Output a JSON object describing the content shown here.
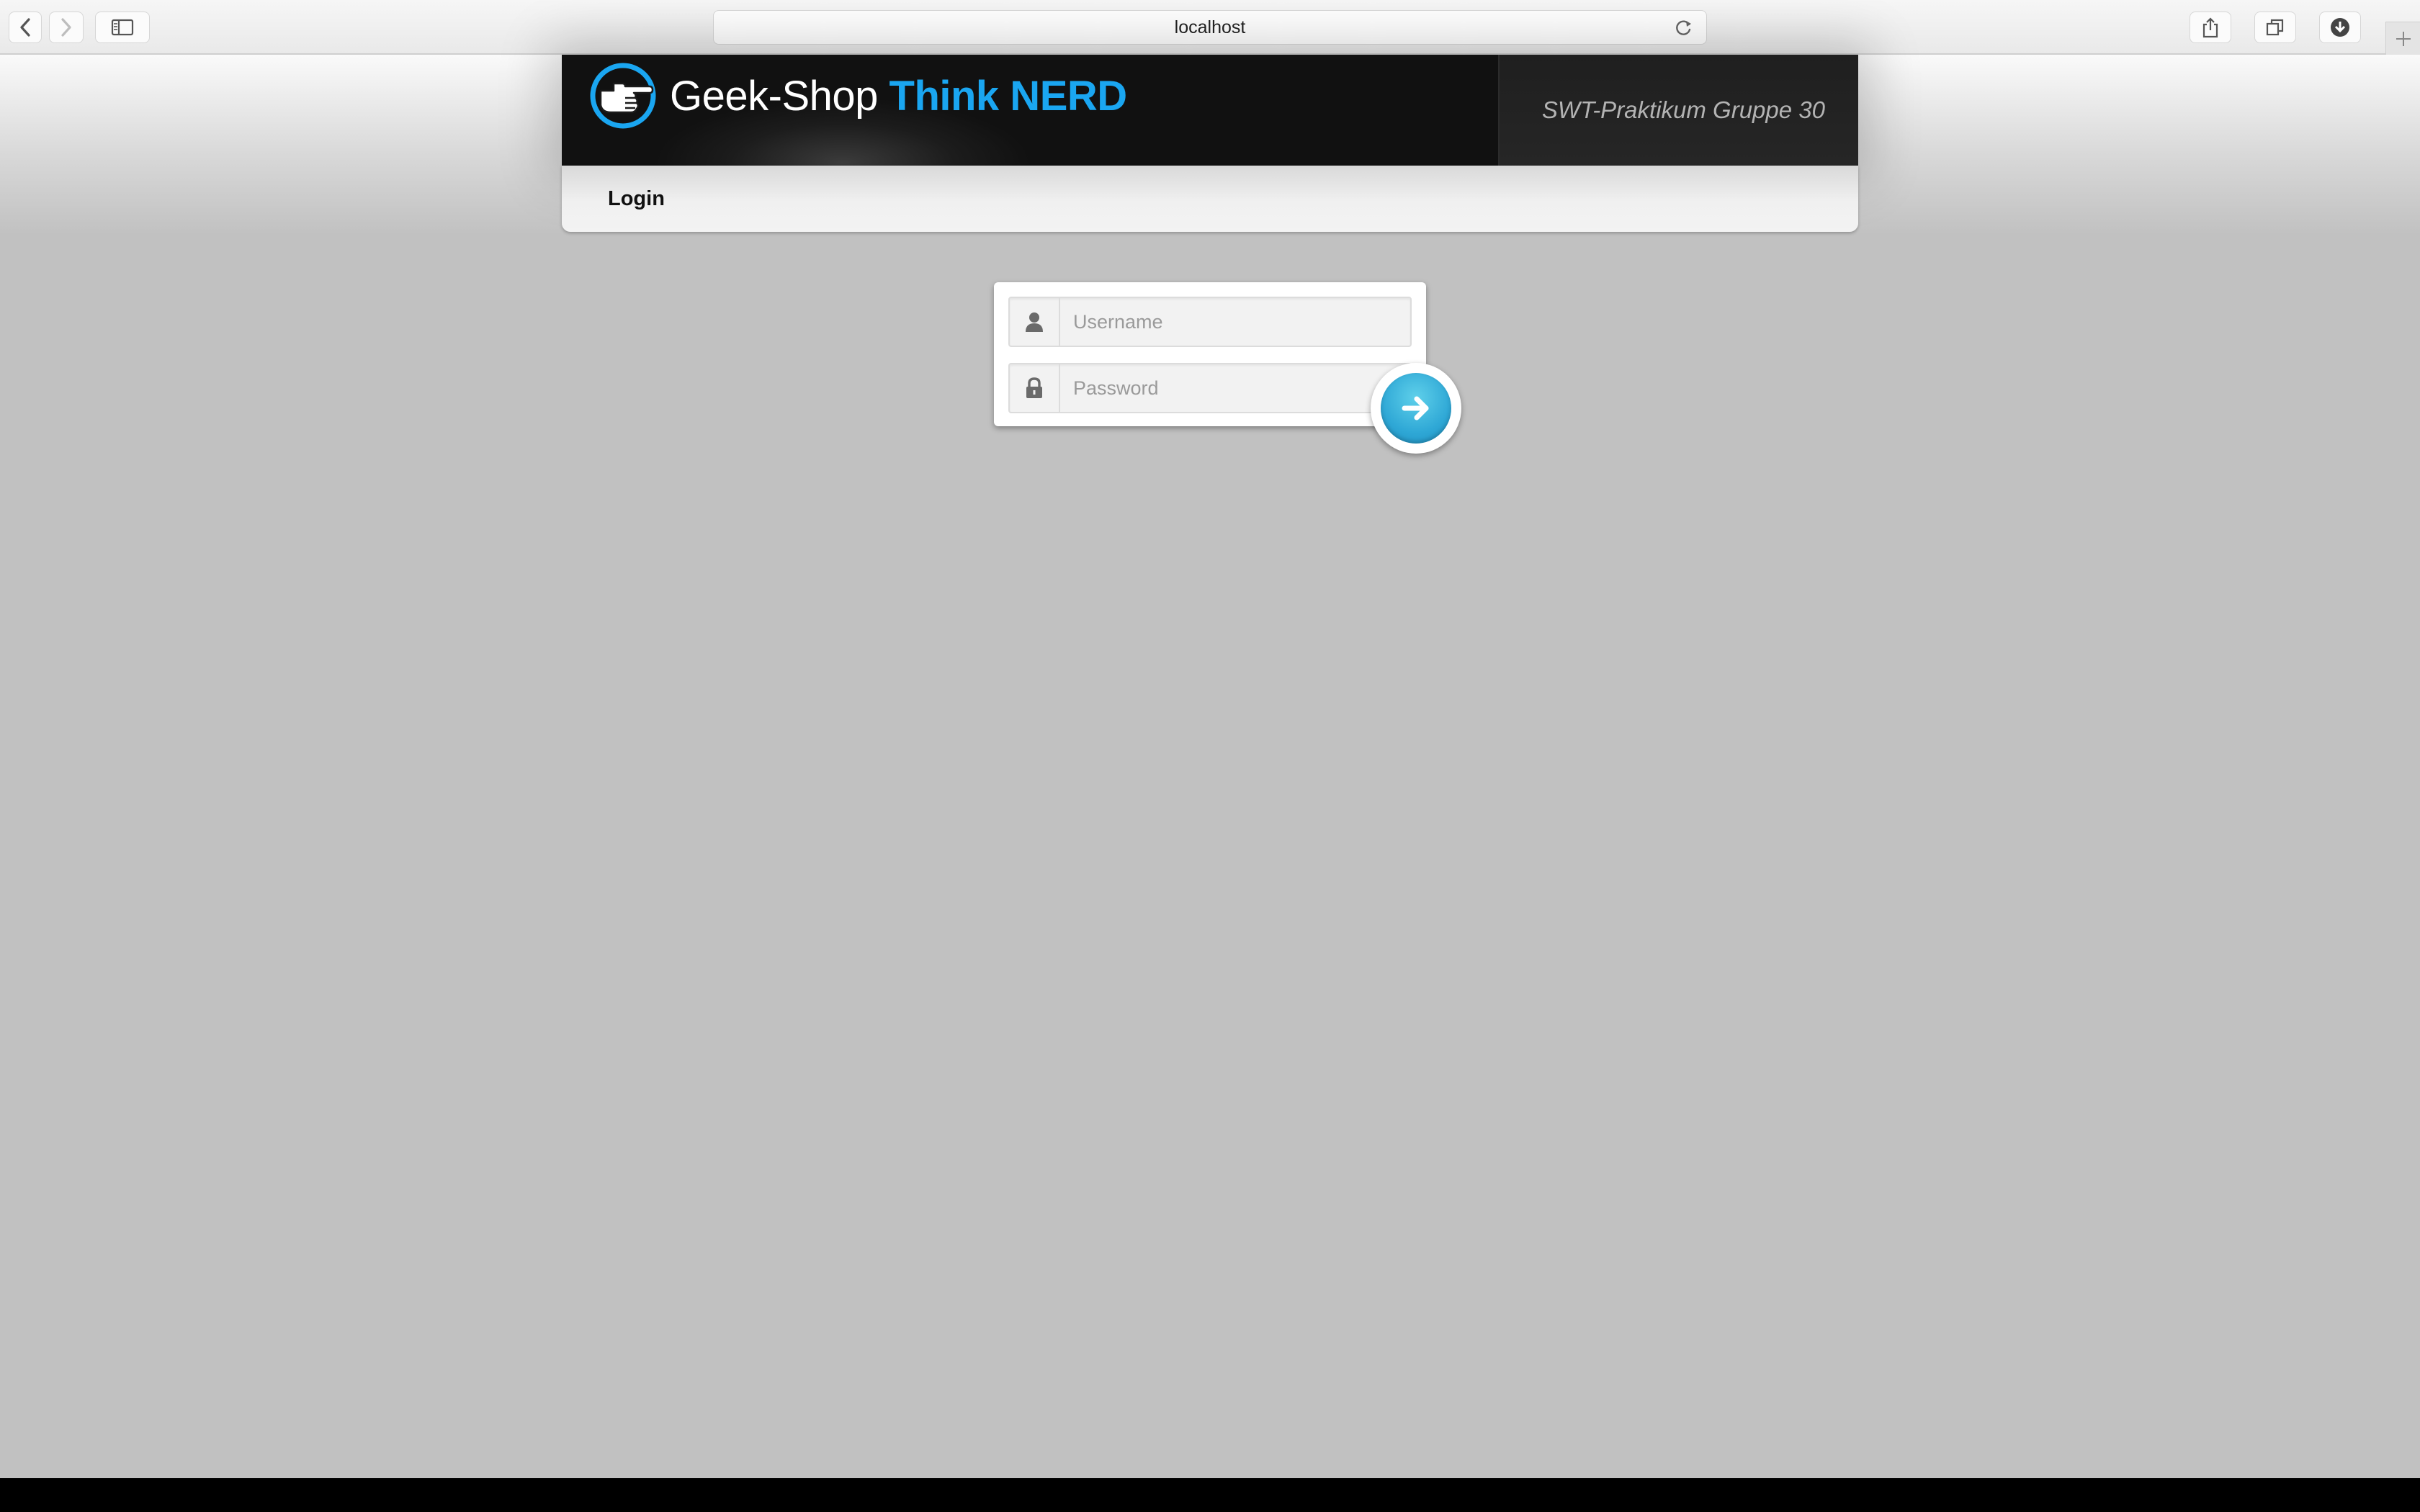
{
  "browser": {
    "url": "localhost",
    "buttons": {
      "back": "back-icon",
      "forward": "forward-icon",
      "sidebar": "sidebar-icon",
      "reload": "reload-icon",
      "share": "share-icon",
      "tabs": "tabs-icon",
      "downloads": "download-icon",
      "new_tab": "plus-icon"
    }
  },
  "header": {
    "brand_primary": "Geek-Shop",
    "brand_secondary": "Think NERD",
    "tagline": "SWT-Praktikum Gruppe 30",
    "logo_icon": "pointing-hand-icon"
  },
  "nav": {
    "login_label": "Login"
  },
  "login_form": {
    "username_placeholder": "Username",
    "password_placeholder": "Password",
    "username_value": "",
    "password_value": "",
    "user_icon": "user-icon",
    "lock_icon": "lock-icon",
    "submit_icon": "arrow-right-icon"
  },
  "colors": {
    "brand_blue": "#1aa6f1",
    "submit_blue": "#2fa8d6",
    "page_background": "#c1c1c1",
    "header_background": "#1c1c1c"
  }
}
